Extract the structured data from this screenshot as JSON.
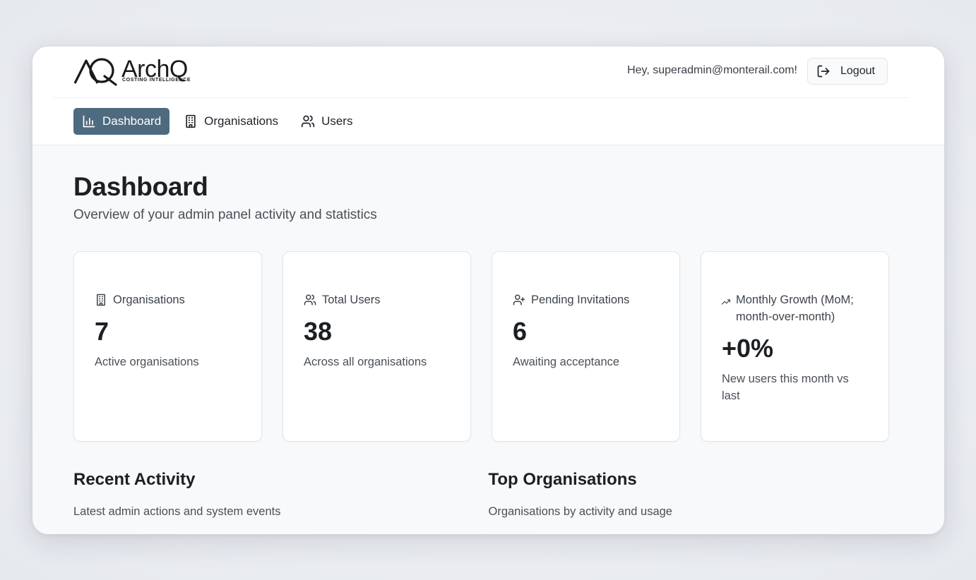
{
  "brand": {
    "name": "ArchQ",
    "tagline": "COSTING INTELLIGENCE"
  },
  "header": {
    "greeting": "Hey, superadmin@monterail.com!",
    "logout_label": "Logout"
  },
  "nav": [
    {
      "label": "Dashboard",
      "icon": "bar-chart-icon",
      "active": true
    },
    {
      "label": "Organisations",
      "icon": "building-icon",
      "active": false
    },
    {
      "label": "Users",
      "icon": "users-icon",
      "active": false
    }
  ],
  "page": {
    "title": "Dashboard",
    "subtitle": "Overview of your admin panel activity and statistics"
  },
  "stats": [
    {
      "label": "Organisations",
      "icon": "building-icon",
      "value": "7",
      "description": "Active organisations"
    },
    {
      "label": "Total Users",
      "icon": "users-icon",
      "value": "38",
      "description": "Across all organisations"
    },
    {
      "label": "Pending Invitations",
      "icon": "user-plus-icon",
      "value": "6",
      "description": "Awaiting acceptance"
    },
    {
      "label": "Monthly Growth (MoM; month-over-month)",
      "icon": "trending-up-icon",
      "value": "+0%",
      "description": "New users this month vs last"
    }
  ],
  "sections": {
    "recent_activity": {
      "title": "Recent Activity",
      "subtitle": "Latest admin actions and system events"
    },
    "top_organisations": {
      "title": "Top Organisations",
      "subtitle": "Organisations by activity and usage"
    }
  },
  "colors": {
    "nav_active_bg": "#4e6a7e",
    "page_bg": "#f8f9fb",
    "card_bg": "#ffffff"
  }
}
